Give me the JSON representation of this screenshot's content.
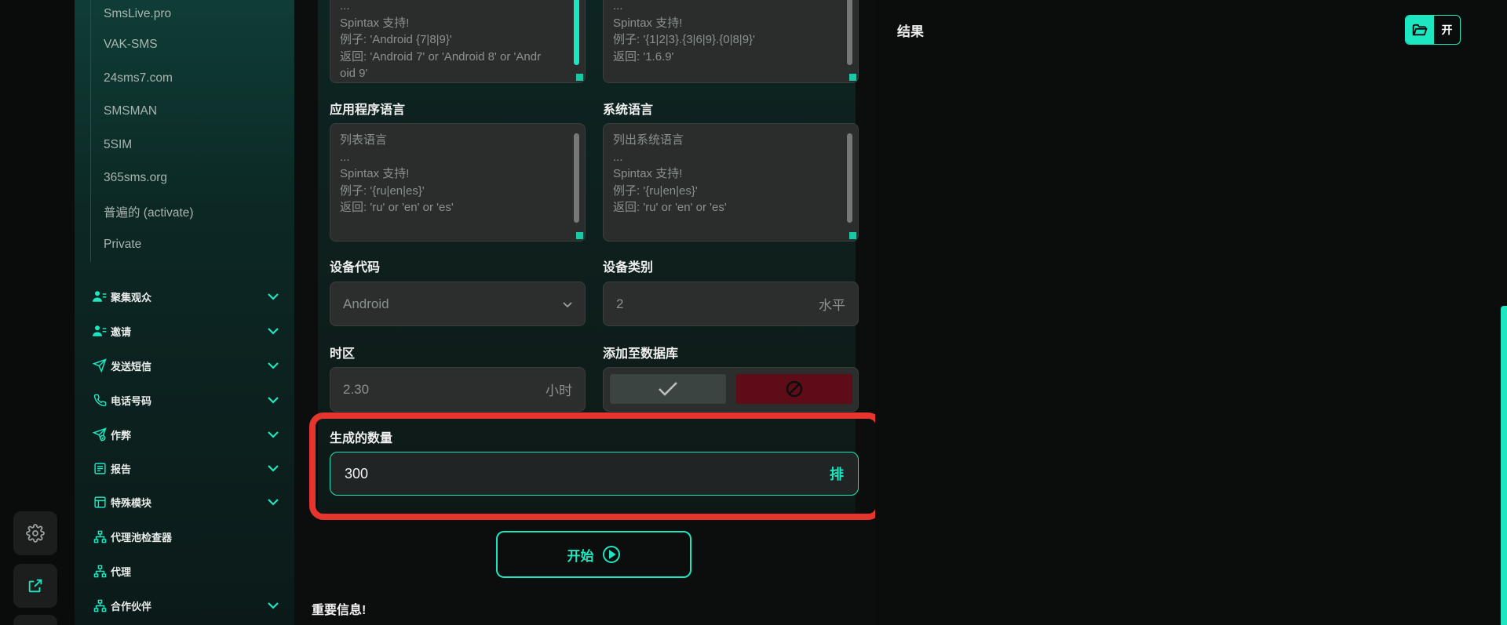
{
  "sidebar": {
    "sub_items": [
      "SmsLive.pro",
      "VAK-SMS",
      "24sms7.com",
      "SMSMAN",
      "5SIM",
      "365sms.org",
      "普遍的 (activate)",
      "Private"
    ],
    "nav": [
      {
        "label": "聚集观众",
        "icon": "users-icon",
        "expandable": true
      },
      {
        "label": "邀请",
        "icon": "user-plus-icon",
        "expandable": true
      },
      {
        "label": "发送短信",
        "icon": "send-icon",
        "expandable": true
      },
      {
        "label": "电话号码",
        "icon": "phone-icon",
        "expandable": true
      },
      {
        "label": "作弊",
        "icon": "send-check-icon",
        "expandable": true
      },
      {
        "label": "报告",
        "icon": "report-icon",
        "expandable": true
      },
      {
        "label": "特殊模块",
        "icon": "module-icon",
        "expandable": true
      },
      {
        "label": "代理池检查器",
        "icon": "network-icon",
        "expandable": false
      },
      {
        "label": "代理",
        "icon": "network-icon",
        "expandable": false
      },
      {
        "label": "合作伙伴",
        "icon": "network-icon",
        "expandable": true
      }
    ]
  },
  "form": {
    "top_left_lines": [
      "...",
      "Spintax 支持!",
      "例子: 'Android {7|8|9}'",
      "返回: 'Android 7' or 'Android 8' or 'Andr",
      "oid 9'"
    ],
    "top_right_lines": [
      "...",
      "Spintax 支持!",
      "例子: '{1|2|3}.{3|6|9}.{0|8|9}'",
      "返回: '1.6.9'"
    ],
    "app_lang_label": "应用程序语言",
    "app_lang_lines": [
      "列表语言",
      "...",
      "Spintax 支持!",
      "例子: '{ru|en|es}'",
      "返回: 'ru' or 'en' or 'es'"
    ],
    "sys_lang_label": "系统语言",
    "sys_lang_lines": [
      "列出系统语言",
      "...",
      "Spintax 支持!",
      "例子: '{ru|en|es}'",
      "返回: 'ru' or 'en' or 'es'"
    ],
    "device_code_label": "设备代码",
    "device_code_value": "Android",
    "device_class_label": "设备类别",
    "device_class_value": "2",
    "device_class_suffix": "水平",
    "timezone_label": "时区",
    "timezone_value": "2.30",
    "timezone_suffix": "小时",
    "add_db_label": "添加至数据库",
    "count_label": "生成的数量",
    "count_value": "300",
    "count_suffix": "排",
    "start_label": "开始",
    "info_title": "重要信息!"
  },
  "results": {
    "title": "结果",
    "open_label": "开"
  },
  "colors": {
    "accent": "#1de7c0",
    "highlight": "#e5352d",
    "danger": "#5e0d18"
  }
}
